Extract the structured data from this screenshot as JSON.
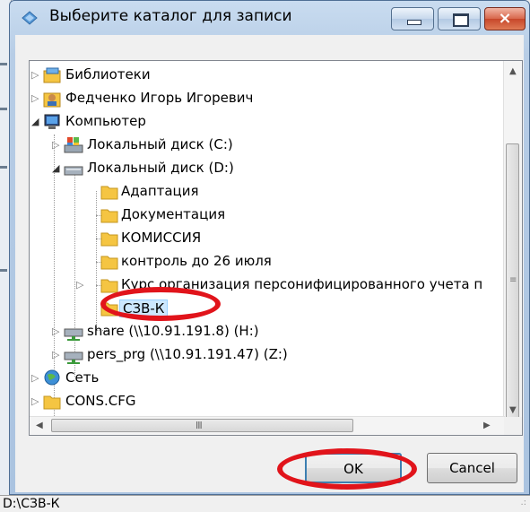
{
  "window": {
    "title": "Выберите каталог для записи",
    "controls": {
      "minimize": "minimize",
      "maximize": "maximize",
      "close": "×"
    }
  },
  "tree": {
    "libraries": "Библиотеки",
    "user": "Федченко Игорь Игоревич",
    "computer": "Компьютер",
    "disk_c": "Локальный диск (C:)",
    "disk_d": "Локальный диск (D:)",
    "folders_d": [
      "Адаптация",
      "Документация",
      "КОМИССИЯ",
      "контроль до 26 июля",
      "Курс организация персонифицированного учета п",
      "СЗВ-К"
    ],
    "share_h": "share (\\\\10.91.191.8) (H:)",
    "pers_z": "pers_prg (\\\\10.91.191.47) (Z:)",
    "network": "Сеть",
    "cons": "CONS.CFG",
    "selected": "СЗВ-К"
  },
  "scroll": {
    "h_grip": "III",
    "v_grip": "≡"
  },
  "buttons": {
    "ok": "OK",
    "cancel": "Cancel"
  },
  "status": {
    "path": "D:\\СЗВ-К",
    "grip": ".:"
  },
  "colors": {
    "selection": "#cce8ff",
    "annotation": "#e1141b",
    "folder": "#f5c542"
  }
}
